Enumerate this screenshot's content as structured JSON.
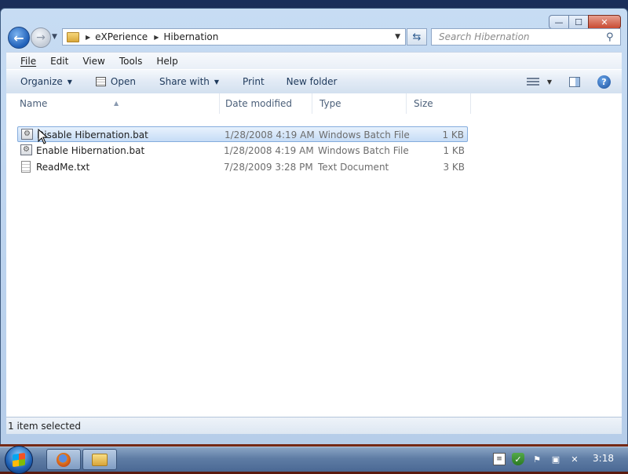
{
  "window": {
    "minimize": "—",
    "maximize": "☐",
    "close": "✕"
  },
  "nav": {
    "back": "←",
    "forward": "→",
    "breadcrumbs": [
      "eXPerience",
      "Hibernation"
    ],
    "search_placeholder": "Search Hibernation"
  },
  "menu": [
    "File",
    "Edit",
    "View",
    "Tools",
    "Help"
  ],
  "commands": {
    "organize": "Organize",
    "open": "Open",
    "share_with": "Share with",
    "print": "Print",
    "new_folder": "New folder",
    "help": "?"
  },
  "columns": {
    "name": "Name",
    "date_modified": "Date modified",
    "type": "Type",
    "size": "Size"
  },
  "files": [
    {
      "name": "Disable Hibernation.bat",
      "date": "1/28/2008 4:19 AM",
      "type": "Windows Batch File",
      "size": "1 KB",
      "icon": "batch-file-icon"
    },
    {
      "name": "Enable Hibernation.bat",
      "date": "1/28/2008 4:19 AM",
      "type": "Windows Batch File",
      "size": "1 KB",
      "icon": "batch-file-icon"
    },
    {
      "name": "ReadMe.txt",
      "date": "7/28/2009 3:28 PM",
      "type": "Text Document",
      "size": "3 KB",
      "icon": "text-file-icon"
    }
  ],
  "selected_row_index": 0,
  "status": "1 item selected",
  "taskbar": {
    "clock": "3:18"
  }
}
